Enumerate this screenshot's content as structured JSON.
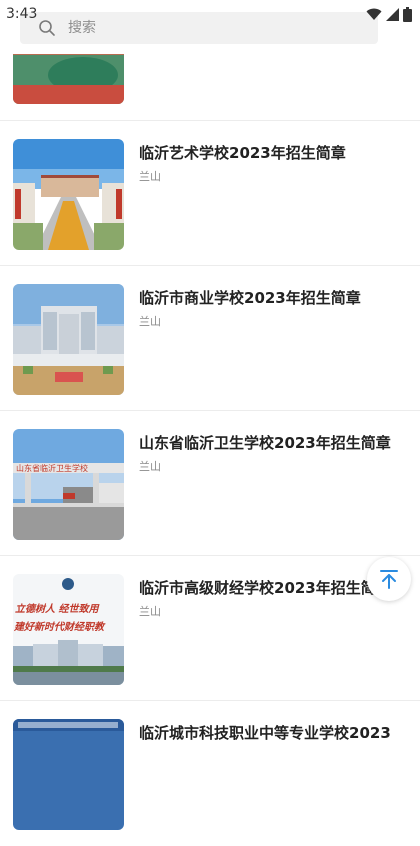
{
  "status": {
    "time": "3:43"
  },
  "search": {
    "placeholder": "搜索"
  },
  "articles": [
    {
      "title": "",
      "source": "兰山"
    },
    {
      "title": "临沂艺术学校2023年招生简章",
      "source": "兰山"
    },
    {
      "title": "临沂市商业学校2023年招生简章",
      "source": "兰山"
    },
    {
      "title": "山东省临沂卫生学校2023年招生简章",
      "source": "兰山"
    },
    {
      "title": "临沂市高级财经学校2023年招生简章",
      "source": "兰山"
    },
    {
      "title": "临沂城市科技职业中等专业学校2023",
      "source": ""
    }
  ],
  "thumb_texts": {
    "health_school_sign": "山东省临沂卫生学校",
    "finance_slogan_1": "立德树人 经世致用",
    "finance_slogan_2": "建好新时代财经职教"
  },
  "colors": {
    "accent": "#2a8be0",
    "title": "#222222",
    "source": "#8a8a8a"
  }
}
